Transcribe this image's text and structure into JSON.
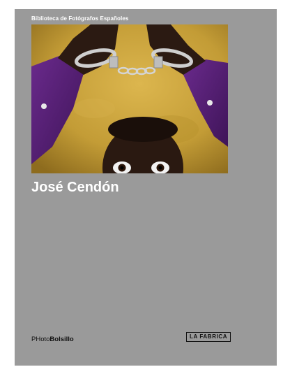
{
  "book": {
    "series_title": "Biblioteca de Fotógrafos Españoles",
    "author_name": "José Cendón",
    "brand_prefix": "PHoto",
    "brand_suffix": "Bolsillo",
    "publisher": "LA FABRICA"
  },
  "colors": {
    "cover_background": "#9a9a9a",
    "photo_wall": "#c9a23a",
    "sleeve": "#5a1f7a",
    "skin": "#2a1a12",
    "cuffs": "#c8c8c8"
  }
}
